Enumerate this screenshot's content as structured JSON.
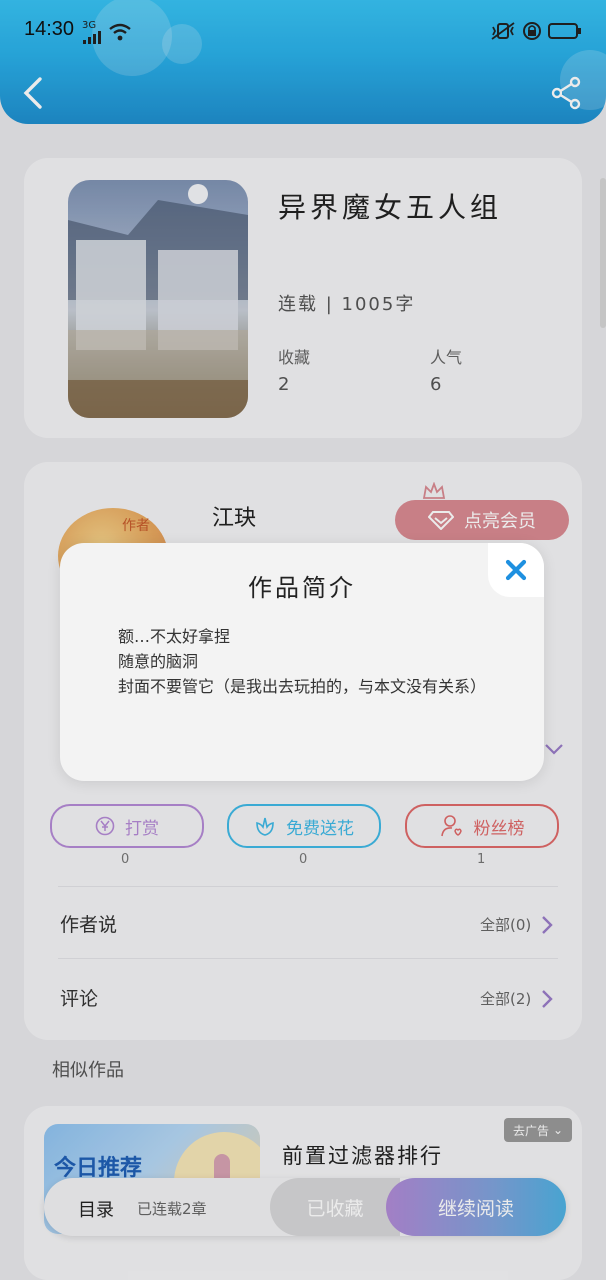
{
  "status_bar": {
    "time": "14:30",
    "network": "3G"
  },
  "book": {
    "title": "异界魔女五人组",
    "meta": "连载 | 1005字",
    "favorites_label": "收藏",
    "favorites_value": "2",
    "popularity_label": "人气",
    "popularity_value": "6"
  },
  "author": {
    "name": "江玦",
    "avatar_tag": "作者",
    "vip_button": "点亮会员"
  },
  "actions": [
    {
      "label": "打赏",
      "count": "0",
      "icon": "yen-icon",
      "color": "#b58ad6"
    },
    {
      "label": "免费送花",
      "count": "0",
      "icon": "flower-icon",
      "color": "#3fb9e6"
    },
    {
      "label": "粉丝榜",
      "count": "1",
      "icon": "fan-user-icon",
      "color": "#e06a6a"
    }
  ],
  "rows": [
    {
      "label": "作者说",
      "right": "全部(0)"
    },
    {
      "label": "评论",
      "right": "全部(2)"
    }
  ],
  "similar": {
    "section_title": "相似作品",
    "item_title": "前置过滤器排行",
    "image_text": "今日推荐",
    "ad_tag": "去广告"
  },
  "bottom_bar": {
    "toc": "目录",
    "status": "已连载2章",
    "favorited": "已收藏",
    "continue": "继续阅读"
  },
  "modal": {
    "title": "作品简介",
    "lines": [
      "额…不太好拿捏",
      "随意的脑洞",
      "封面不要管它（是我出去玩拍的，与本文没有关系）"
    ]
  },
  "colors": {
    "header": "#2ab0e9",
    "accent_purple": "#b58ad6",
    "accent_blue": "#3fb9e6",
    "close_blue": "#1e90e0"
  }
}
